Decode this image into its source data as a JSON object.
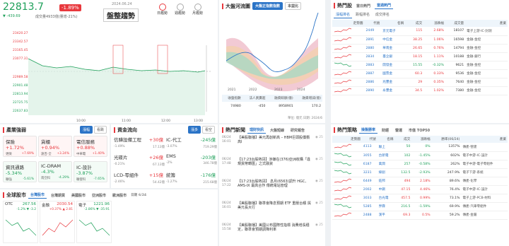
{
  "index": {
    "value": "22813.7",
    "pct": "-1.89%",
    "chg": "▼ -439.69",
    "vol_label": "成交量4933億(量增-21%)",
    "date": "2024.06.24",
    "trend": "盤整趨勢",
    "btns": [
      "日趨勢",
      "週趨勢",
      "月趨勢"
    ],
    "yticks": [
      "23420.27",
      "23342.57",
      "23165.45",
      "23077.31",
      "22989.58",
      "22901.48",
      "22813.94",
      "22725.75",
      "22637.83"
    ],
    "xticks": [
      "10:00",
      "11:00",
      "12:00",
      "13:00"
    ]
  },
  "sector": {
    "title": "產業強弱",
    "tabs": [
      "漲幅",
      "看跌"
    ],
    "items": [
      {
        "t": "保險",
        "v": "+1.72%",
        "a": "更險",
        "b": "+7.69%"
      },
      {
        "t": "貨櫃",
        "v": "+0.94%",
        "a": "遠百-全",
        "b": "+3.24%"
      },
      {
        "t": "電信服務",
        "v": "+0.88%",
        "a": "中華電",
        "b": "+1.40%"
      },
      {
        "t": "資訊通路",
        "v": "-5.34%",
        "a": "聯強",
        "b": "-5.61%"
      },
      {
        "t": "IC-DRAM",
        "v": "-4.3%",
        "a": "南亞科",
        "b": "-4.29%"
      },
      {
        "t": "IC-設計",
        "v": "-3.87%",
        "a": "聯發科",
        "b": "-7.65%"
      }
    ]
  },
  "flow": {
    "title": "資金流向",
    "tabs": [
      "漲多",
      "看空"
    ],
    "items": [
      {
        "n": "信驊設備工程",
        "v": "+30億",
        "a": "-1.49%",
        "b": "17.13億"
      },
      {
        "n": "IC-代工",
        "v": "-245億",
        "a": "-3.07%",
        "b": "719.29億"
      },
      {
        "n": "光碟片",
        "v": "+26億",
        "a": "-0.21%",
        "b": "67.13億"
      },
      {
        "n": "EMS",
        "v": "-203億",
        "a": "-2%",
        "b": "346.78億"
      },
      {
        "n": "LCD-零組件",
        "v": "+15億",
        "a": "-2.46%",
        "b": "54.42億"
      },
      {
        "n": "統籌",
        "v": "-176億",
        "a": "-1.27%",
        "b": "215.68億"
      }
    ]
  },
  "global": {
    "title": "全球股市",
    "tabs": [
      "台灣股市",
      "台灣期貨",
      "美國股市",
      "亞洲股市",
      "歐洲股市"
    ],
    "date": "日期 6/24",
    "cards": [
      {
        "n": "OTC",
        "v": "267.56",
        "c": "-1.2%  ▼ -3.2"
      },
      {
        "n": "金融",
        "v": "2030.54",
        "c": "+0.37%  ▲ 2.81"
      },
      {
        "n": "電子",
        "v": "1221.96",
        "c": "-2.86%  ▼ -35.91"
      }
    ]
  },
  "tide": {
    "title": "大盤河流圖",
    "btns": [
      "大盤正指數指數",
      "本益比"
    ],
    "xticks": [
      "2021",
      "2022",
      "2023",
      "2024"
    ],
    "headers": [
      "收盤指數",
      "法人買賣超",
      "融資餘額(億)",
      "融資增減(億)"
    ],
    "vals": [
      "74980",
      "-450",
      "8958901",
      "170.2"
    ],
    "unit": "單位: 億元",
    "date": "日期: 2024/6"
  },
  "news": {
    "title": "熱門新聞",
    "tabs": [
      "理財快訊",
      "大盤短線",
      "研究報告"
    ],
    "items": [
      {
        "d": "06/24 16:01",
        "t": "【美股聯播】美元再創新高 – HBM巨頭股價衝高Ⅰ",
        "c": "25"
      },
      {
        "d": "06/24 17:48",
        "t": "【17:23台股熱訊】涉嫌在(376)亞洲收購「違規貨幣轉匯」之式融資",
        "c": "25"
      },
      {
        "d": "06/24 17:22",
        "t": "【17:23台股熱訊】 息月(6563)調升 HGC、AMS-IX 最高合作 傳統電站管理",
        "c": "25"
      },
      {
        "d": "06/24 16:01",
        "t": "【美股聯播】聯準會降息預期 ETF 重壓台積 與美元長大行",
        "c": "25"
      },
      {
        "d": "06/24 15:58",
        "t": "【美股聯播】美國公布國際性指標 消費增長穩定，聯準會預期調降利率",
        "c": "25"
      }
    ]
  },
  "stocks": {
    "title": "熱門股",
    "tabs": [
      "當日熱門",
      "當週熱門"
    ],
    "sub": [
      "漲幅排名",
      "跌幅排名",
      "成交排名"
    ],
    "headers": [
      "走勢圖",
      "代號",
      "名稱",
      "成交",
      "漲跌幅",
      "成交量",
      "產業"
    ],
    "rows": [
      [
        "2449",
        "京元電子",
        "115",
        "2.68%",
        "18107",
        "電子上游-IC-封測"
      ],
      [
        "2891",
        "中信金",
        "38.25",
        "1.06%",
        "16598",
        "金融-金控"
      ],
      [
        "2880",
        "華南金",
        "26.65",
        "0.76%",
        "14794",
        "金融-金控"
      ],
      [
        "2834",
        "臺企銀",
        "18.15",
        "1.11%",
        "10188",
        "金融-銀行"
      ],
      [
        "2883",
        "開發金",
        "15.55",
        "-0.32%",
        "9621",
        "金融-金控"
      ],
      [
        "2887",
        "國票金",
        "60.3",
        "0.33%",
        "9536",
        "金融-金控"
      ],
      [
        "2886",
        "兆豐金",
        "29",
        "0.35%",
        "7640",
        "金融-金控"
      ],
      [
        "2890",
        "永豐金",
        "34.5",
        "1.02%",
        "7380",
        "金融-金控"
      ]
    ]
  },
  "strategy": {
    "title": "熱門策略",
    "tabs": [
      "操盤勝率",
      "財經",
      "營運",
      "市值 TOP50"
    ],
    "headers": [
      "走勢圖",
      "代號",
      "名稱",
      "成交",
      "漲跌幅",
      "勝率(06/24)",
      "產業"
    ],
    "rows": [
      [
        "4113",
        "聯上",
        "50",
        "0%",
        "1357%",
        "傳產-營建"
      ],
      [
        "3055",
        "台新電",
        "102",
        "-1.45%",
        "602%",
        "電子中游-IC-設計"
      ],
      [
        "6187",
        "萬潤",
        "257",
        "-0.58%",
        "262%",
        "電子中游-電子零組件"
      ],
      [
        "3231",
        "緯創",
        "132.5",
        "-2.93%",
        "247.9%",
        "電子下游-系統"
      ],
      [
        "6449",
        "鈺邦",
        "494",
        "2.18%",
        "89.6%",
        "傳產-化學"
      ],
      [
        "2002",
        "中鋼",
        "47.15",
        "4.46%",
        "76.4%",
        "電子中游-IC-設計"
      ],
      [
        "3033",
        "台光電",
        "457.5",
        "0.99%",
        "73.1%",
        "電子上游-PCB-材料"
      ],
      [
        "5285",
        "界霖",
        "216.5",
        "-1.59%",
        "69.9%",
        "傳產-汽車零組件"
      ],
      [
        "2488",
        "漢平",
        "69.3",
        "0.5%",
        "59.2%",
        "傳產-金屬"
      ]
    ]
  }
}
